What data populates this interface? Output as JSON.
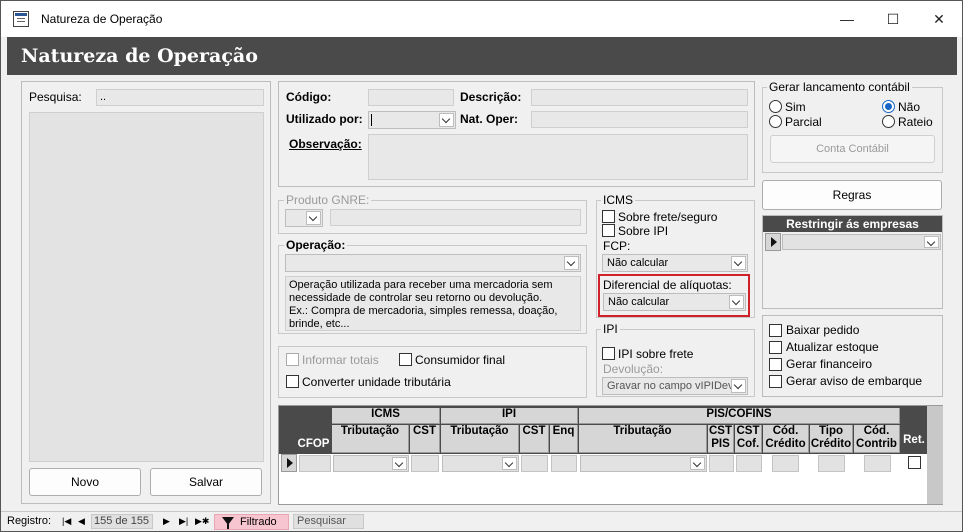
{
  "window": {
    "title": "Natureza de Operação",
    "minimize_glyph": "—",
    "maximize_glyph": "☐",
    "close_glyph": "✕"
  },
  "header": {
    "title": "Natureza de Operação"
  },
  "search_panel": {
    "label": "Pesquisa:",
    "value": "..",
    "new_button": "Novo",
    "save_button": "Salvar"
  },
  "form": {
    "codigo_label": "Código:",
    "descricao_label": "Descrição:",
    "utilizado_label": "Utilizado por:",
    "natoper_label": "Nat. Oper:",
    "observacao_label": "Observação:"
  },
  "gerar": {
    "title": "Gerar lancamento contábil",
    "sim": "Sim",
    "nao": "Não",
    "parcial": "Parcial",
    "rateio": "Rateio",
    "selected": "Não",
    "conta_button": "Conta Contábil"
  },
  "regras_button": "Regras",
  "restringir": {
    "title": "Restringir ás empresas"
  },
  "produto_gnre": {
    "title": "Produto GNRE:"
  },
  "operacao": {
    "title": "Operação:",
    "description": "Operação utilizada para receber uma mercadoria sem necessidade de controlar seu retorno ou devolução.\nEx.: Compra de mercadoria, simples remessa, doação, brinde, etc..."
  },
  "icms": {
    "title": "ICMS",
    "sobre_frete": "Sobre frete/seguro",
    "sobre_ipi": "Sobre IPI",
    "fcp_label": "FCP:",
    "fcp_value": "Não calcular",
    "difal_label": "Diferencial de alíquotas:",
    "difal_value": "Não calcular"
  },
  "ipi": {
    "title": "IPI",
    "sobre_frete": "IPI sobre frete",
    "devolucao_label": "Devolução:",
    "devolucao_value": "Gravar no campo vIPIDev"
  },
  "flags": {
    "informar_totais": "Informar totais",
    "consumidor_final": "Consumidor final",
    "converter_unidade": "Converter unidade tributária"
  },
  "options": {
    "baixar_pedido": "Baixar pedido",
    "atualizar_estoque": "Atualizar estoque",
    "gerar_financeiro": "Gerar financeiro",
    "gerar_aviso": "Gerar aviso de embarque"
  },
  "grid": {
    "cfop": "CFOP",
    "icms_group": "ICMS",
    "ipi_group": "IPI",
    "pis_group": "PIS/COFINS",
    "icms_trib": "Tributação",
    "icms_cst": "CST",
    "ipi_trib": "Tributação",
    "ipi_cst": "CST",
    "ipi_enq": "Enq",
    "pis_trib": "Tributação",
    "cst_pis": "CST PIS",
    "cst_cof": "CST Cof.",
    "cod_credito": "Cód. Crédito",
    "tipo_credito": "Tipo Crédito",
    "cod_contrib": "Cód. Contrib",
    "ret": "Ret."
  },
  "statusbar": {
    "registro_label": "Registro:",
    "position": "155 de 155",
    "filter_label": "Filtrado",
    "search_label": "Pesquisar"
  },
  "colors": {
    "header_bg": "#4a4a4a",
    "highlight_border": "#d0202a",
    "filter_bg": "#f7c5cf",
    "radio_accent": "#1a66c7"
  }
}
